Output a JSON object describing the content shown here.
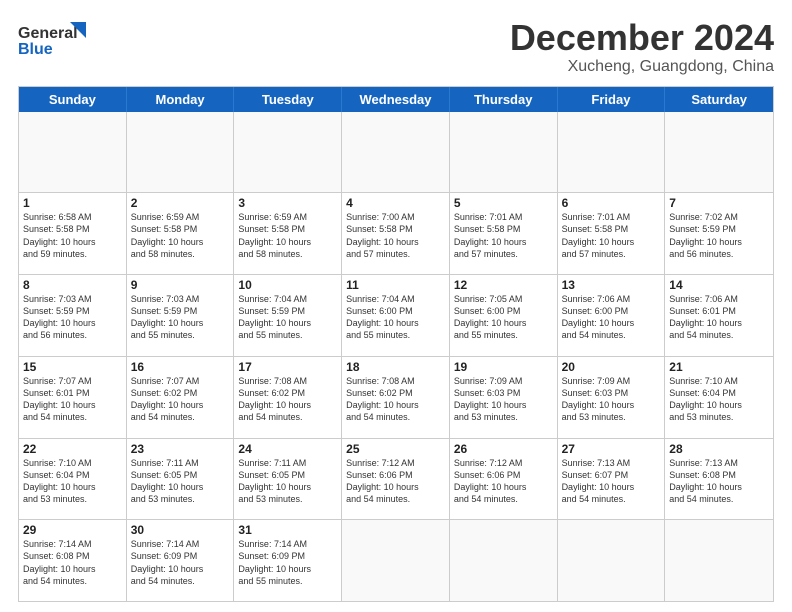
{
  "header": {
    "logo_line1": "General",
    "logo_line2": "Blue",
    "main_title": "December 2024",
    "subtitle": "Xucheng, Guangdong, China"
  },
  "calendar": {
    "days_of_week": [
      "Sunday",
      "Monday",
      "Tuesday",
      "Wednesday",
      "Thursday",
      "Friday",
      "Saturday"
    ],
    "weeks": [
      [
        {
          "day": "",
          "empty": true
        },
        {
          "day": "",
          "empty": true
        },
        {
          "day": "",
          "empty": true
        },
        {
          "day": "",
          "empty": true
        },
        {
          "day": "",
          "empty": true
        },
        {
          "day": "",
          "empty": true
        },
        {
          "day": "",
          "empty": true
        }
      ],
      [
        {
          "num": "1",
          "text": "Sunrise: 6:58 AM\nSunset: 5:58 PM\nDaylight: 10 hours\nand 59 minutes."
        },
        {
          "num": "2",
          "text": "Sunrise: 6:59 AM\nSunset: 5:58 PM\nDaylight: 10 hours\nand 58 minutes."
        },
        {
          "num": "3",
          "text": "Sunrise: 6:59 AM\nSunset: 5:58 PM\nDaylight: 10 hours\nand 58 minutes."
        },
        {
          "num": "4",
          "text": "Sunrise: 7:00 AM\nSunset: 5:58 PM\nDaylight: 10 hours\nand 57 minutes."
        },
        {
          "num": "5",
          "text": "Sunrise: 7:01 AM\nSunset: 5:58 PM\nDaylight: 10 hours\nand 57 minutes."
        },
        {
          "num": "6",
          "text": "Sunrise: 7:01 AM\nSunset: 5:58 PM\nDaylight: 10 hours\nand 57 minutes."
        },
        {
          "num": "7",
          "text": "Sunrise: 7:02 AM\nSunset: 5:59 PM\nDaylight: 10 hours\nand 56 minutes."
        }
      ],
      [
        {
          "num": "8",
          "text": "Sunrise: 7:03 AM\nSunset: 5:59 PM\nDaylight: 10 hours\nand 56 minutes."
        },
        {
          "num": "9",
          "text": "Sunrise: 7:03 AM\nSunset: 5:59 PM\nDaylight: 10 hours\nand 55 minutes."
        },
        {
          "num": "10",
          "text": "Sunrise: 7:04 AM\nSunset: 5:59 PM\nDaylight: 10 hours\nand 55 minutes."
        },
        {
          "num": "11",
          "text": "Sunrise: 7:04 AM\nSunset: 6:00 PM\nDaylight: 10 hours\nand 55 minutes."
        },
        {
          "num": "12",
          "text": "Sunrise: 7:05 AM\nSunset: 6:00 PM\nDaylight: 10 hours\nand 55 minutes."
        },
        {
          "num": "13",
          "text": "Sunrise: 7:06 AM\nSunset: 6:00 PM\nDaylight: 10 hours\nand 54 minutes."
        },
        {
          "num": "14",
          "text": "Sunrise: 7:06 AM\nSunset: 6:01 PM\nDaylight: 10 hours\nand 54 minutes."
        }
      ],
      [
        {
          "num": "15",
          "text": "Sunrise: 7:07 AM\nSunset: 6:01 PM\nDaylight: 10 hours\nand 54 minutes."
        },
        {
          "num": "16",
          "text": "Sunrise: 7:07 AM\nSunset: 6:02 PM\nDaylight: 10 hours\nand 54 minutes."
        },
        {
          "num": "17",
          "text": "Sunrise: 7:08 AM\nSunset: 6:02 PM\nDaylight: 10 hours\nand 54 minutes."
        },
        {
          "num": "18",
          "text": "Sunrise: 7:08 AM\nSunset: 6:02 PM\nDaylight: 10 hours\nand 54 minutes."
        },
        {
          "num": "19",
          "text": "Sunrise: 7:09 AM\nSunset: 6:03 PM\nDaylight: 10 hours\nand 53 minutes."
        },
        {
          "num": "20",
          "text": "Sunrise: 7:09 AM\nSunset: 6:03 PM\nDaylight: 10 hours\nand 53 minutes."
        },
        {
          "num": "21",
          "text": "Sunrise: 7:10 AM\nSunset: 6:04 PM\nDaylight: 10 hours\nand 53 minutes."
        }
      ],
      [
        {
          "num": "22",
          "text": "Sunrise: 7:10 AM\nSunset: 6:04 PM\nDaylight: 10 hours\nand 53 minutes."
        },
        {
          "num": "23",
          "text": "Sunrise: 7:11 AM\nSunset: 6:05 PM\nDaylight: 10 hours\nand 53 minutes."
        },
        {
          "num": "24",
          "text": "Sunrise: 7:11 AM\nSunset: 6:05 PM\nDaylight: 10 hours\nand 53 minutes."
        },
        {
          "num": "25",
          "text": "Sunrise: 7:12 AM\nSunset: 6:06 PM\nDaylight: 10 hours\nand 54 minutes."
        },
        {
          "num": "26",
          "text": "Sunrise: 7:12 AM\nSunset: 6:06 PM\nDaylight: 10 hours\nand 54 minutes."
        },
        {
          "num": "27",
          "text": "Sunrise: 7:13 AM\nSunset: 6:07 PM\nDaylight: 10 hours\nand 54 minutes."
        },
        {
          "num": "28",
          "text": "Sunrise: 7:13 AM\nSunset: 6:08 PM\nDaylight: 10 hours\nand 54 minutes."
        }
      ],
      [
        {
          "num": "29",
          "text": "Sunrise: 7:14 AM\nSunset: 6:08 PM\nDaylight: 10 hours\nand 54 minutes."
        },
        {
          "num": "30",
          "text": "Sunrise: 7:14 AM\nSunset: 6:09 PM\nDaylight: 10 hours\nand 54 minutes."
        },
        {
          "num": "31",
          "text": "Sunrise: 7:14 AM\nSunset: 6:09 PM\nDaylight: 10 hours\nand 55 minutes."
        },
        {
          "day": "",
          "empty": true
        },
        {
          "day": "",
          "empty": true
        },
        {
          "day": "",
          "empty": true
        },
        {
          "day": "",
          "empty": true
        }
      ]
    ]
  }
}
